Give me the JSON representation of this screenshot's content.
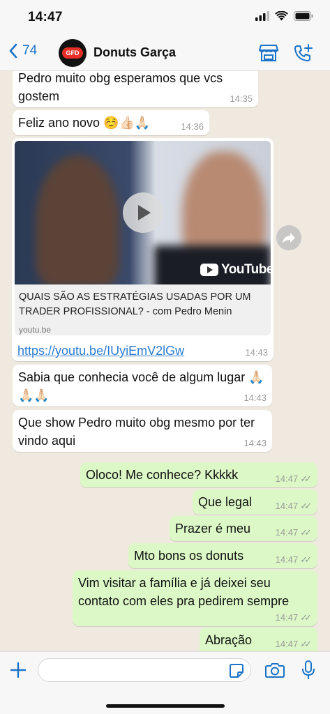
{
  "status_bar": {
    "time": "14:47"
  },
  "header": {
    "back_count": "74",
    "contact_name": "Donuts Garça",
    "avatar_text": "GFD"
  },
  "messages": {
    "m1": {
      "text": "Pedro muito obg esperamos que vcs gostem",
      "time": "14:35"
    },
    "m2": {
      "text": "Feliz ano novo ☺️👍🏻🙏🏻",
      "time": "14:36"
    },
    "m3": {
      "card_title": "QUAIS SÃO AS ESTRATÉGIAS USADAS POR UM TRADER PROFISSIONAL? - com Pedro Menin",
      "card_domain": "youtu.be",
      "video_brand": "YouTube",
      "link": "https://youtu.be/IUyiEmV2lGw",
      "time": "14:43"
    },
    "m4": {
      "text": "Sabia que conhecia você de algum lugar 🙏🏻🙏🏻🙏🏻",
      "time": "14:43"
    },
    "m5": {
      "text": "Que show Pedro muito obg mesmo por ter vindo aqui",
      "time": "14:43"
    },
    "m6": {
      "text": "Oloco! Me conhece? Kkkkk",
      "time": "14:47"
    },
    "m7": {
      "text": "Que legal",
      "time": "14:47"
    },
    "m8": {
      "text": "Prazer é meu",
      "time": "14:47"
    },
    "m9": {
      "text": "Mto bons os donuts",
      "time": "14:47"
    },
    "m10": {
      "text": "Vim visitar a família e já deixei seu contato com eles pra pedirem sempre",
      "time": "14:47"
    },
    "m11": {
      "text": "Abração",
      "time": "14:47"
    }
  },
  "colors": {
    "accent": "#1a73c8",
    "outgoing_bubble": "#dcf8c6",
    "incoming_bubble": "#ffffff",
    "chat_background": "#efe9df"
  },
  "icons": {
    "back": "chevron-left-icon",
    "store": "store-icon",
    "call": "add-call-icon",
    "plus": "plus-icon",
    "sticker": "sticker-icon",
    "camera": "camera-icon",
    "mic": "microphone-icon",
    "forward": "forward-icon",
    "read": "double-check-icon"
  }
}
